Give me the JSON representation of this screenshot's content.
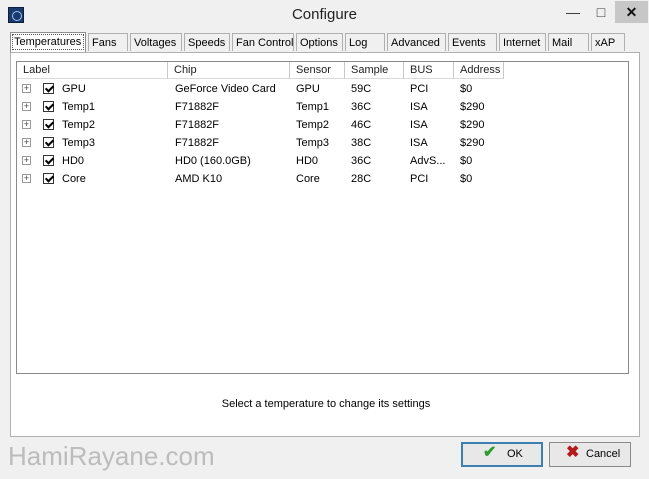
{
  "window": {
    "title": "Configure",
    "controls": {
      "minimize": "—",
      "maximize": "□",
      "close": "✕"
    }
  },
  "tabs": [
    {
      "label": "Temperatures",
      "active": true
    },
    {
      "label": "Fans"
    },
    {
      "label": "Voltages"
    },
    {
      "label": "Speeds"
    },
    {
      "label": "Fan Control"
    },
    {
      "label": "Options"
    },
    {
      "label": "Log"
    },
    {
      "label": "Advanced"
    },
    {
      "label": "Events"
    },
    {
      "label": "Internet"
    },
    {
      "label": "Mail"
    },
    {
      "label": "xAP"
    }
  ],
  "table": {
    "columns": [
      "Label",
      "Chip",
      "Sensor",
      "Sample",
      "BUS",
      "Address"
    ],
    "rows": [
      {
        "label": "GPU",
        "chip": "GeForce Video Card",
        "sensor": "GPU",
        "sample": "59C",
        "bus": "PCI",
        "address": "$0"
      },
      {
        "label": "Temp1",
        "chip": "F71882F",
        "sensor": "Temp1",
        "sample": "36C",
        "bus": "ISA",
        "address": "$290"
      },
      {
        "label": "Temp2",
        "chip": "F71882F",
        "sensor": "Temp2",
        "sample": "46C",
        "bus": "ISA",
        "address": "$290"
      },
      {
        "label": "Temp3",
        "chip": "F71882F",
        "sensor": "Temp3",
        "sample": "38C",
        "bus": "ISA",
        "address": "$290"
      },
      {
        "label": "HD0",
        "chip": "HD0 (160.0GB)",
        "sensor": "HD0",
        "sample": "36C",
        "bus": "AdvS...",
        "address": "$0"
      },
      {
        "label": "Core",
        "chip": "AMD K10",
        "sensor": "Core",
        "sample": "28C",
        "bus": "PCI",
        "address": "$0"
      }
    ]
  },
  "status_text": "Select a temperature to change its settings",
  "watermark": "HamiRayane.com",
  "buttons": {
    "ok": "OK",
    "cancel": "Cancel"
  },
  "icons": {
    "ok": "check-icon",
    "cancel": "x-icon",
    "expander": "expand-icon",
    "checkbox": "checkbox-icon"
  },
  "colors": {
    "ok_icon": "#2a9d2a",
    "cancel_icon": "#b31b1b",
    "ok_border": "#3c7fb1"
  }
}
